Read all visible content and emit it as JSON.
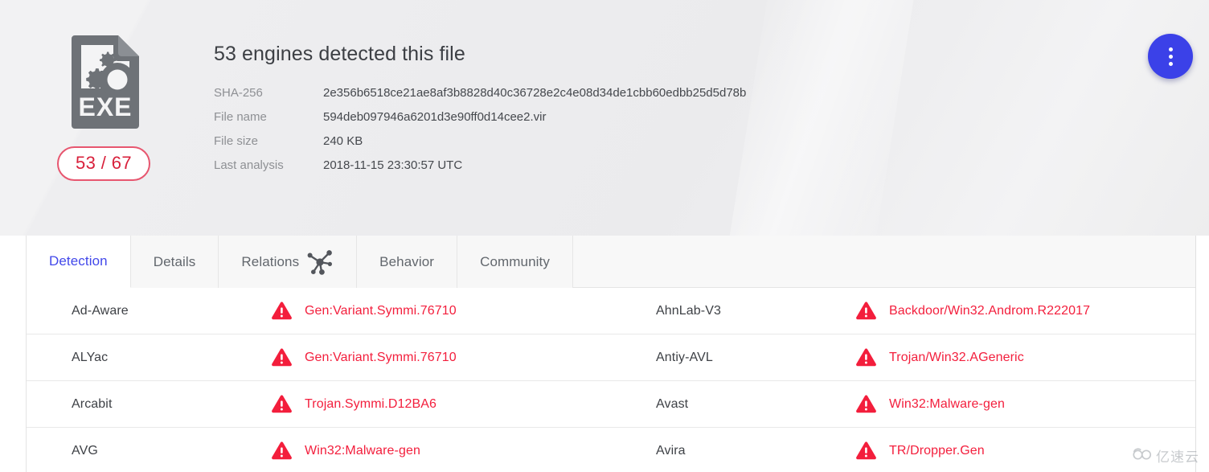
{
  "theme": {
    "accent_blue": "#3b41e8",
    "tab_active_blue": "#4248ea",
    "threat_red": "#f31e3c",
    "score_border_red": "#e7566f",
    "score_text_red": "#d8203b",
    "banner_gray": "#ededee",
    "divider_gray": "#e9e9e9"
  },
  "summary": {
    "headline": "53 engines detected this file",
    "file_type_label": "EXE",
    "file_icon": "exe-file-icon",
    "score": "53 / 67",
    "meta": [
      {
        "label": "SHA-256",
        "value": "2e356b6518ce21ae8af3b8828d40c36728e2c4e08d34de1cbb60edbb25d5d78b"
      },
      {
        "label": "File name",
        "value": "594deb097946a6201d3e90ff0d14cee2.vir"
      },
      {
        "label": "File size",
        "value": "240 KB"
      },
      {
        "label": "Last analysis",
        "value": "2018-11-15 23:30:57 UTC"
      }
    ],
    "more_actions_icon": "more-vertical-icon"
  },
  "tabs": [
    {
      "label": "Detection",
      "active": true,
      "icon": ""
    },
    {
      "label": "Details",
      "active": false,
      "icon": ""
    },
    {
      "label": "Relations",
      "active": false,
      "icon": "graph-nodes-icon"
    },
    {
      "label": "Behavior",
      "active": false,
      "icon": ""
    },
    {
      "label": "Community",
      "active": false,
      "icon": ""
    }
  ],
  "detections": {
    "warning_icon": "warning-triangle-icon",
    "left": [
      {
        "engine": "Ad-Aware",
        "verdict": "Gen:Variant.Symmi.76710"
      },
      {
        "engine": "ALYac",
        "verdict": "Gen:Variant.Symmi.76710"
      },
      {
        "engine": "Arcabit",
        "verdict": "Trojan.Symmi.D12BA6"
      },
      {
        "engine": "AVG",
        "verdict": "Win32:Malware-gen"
      }
    ],
    "right": [
      {
        "engine": "AhnLab-V3",
        "verdict": "Backdoor/Win32.Androm.R222017"
      },
      {
        "engine": "Antiy-AVL",
        "verdict": "Trojan/Win32.AGeneric"
      },
      {
        "engine": "Avast",
        "verdict": "Win32:Malware-gen"
      },
      {
        "engine": "Avira",
        "verdict": "TR/Dropper.Gen"
      }
    ]
  },
  "watermark": {
    "text": "亿速云",
    "icon": "cloud-logo-icon"
  }
}
